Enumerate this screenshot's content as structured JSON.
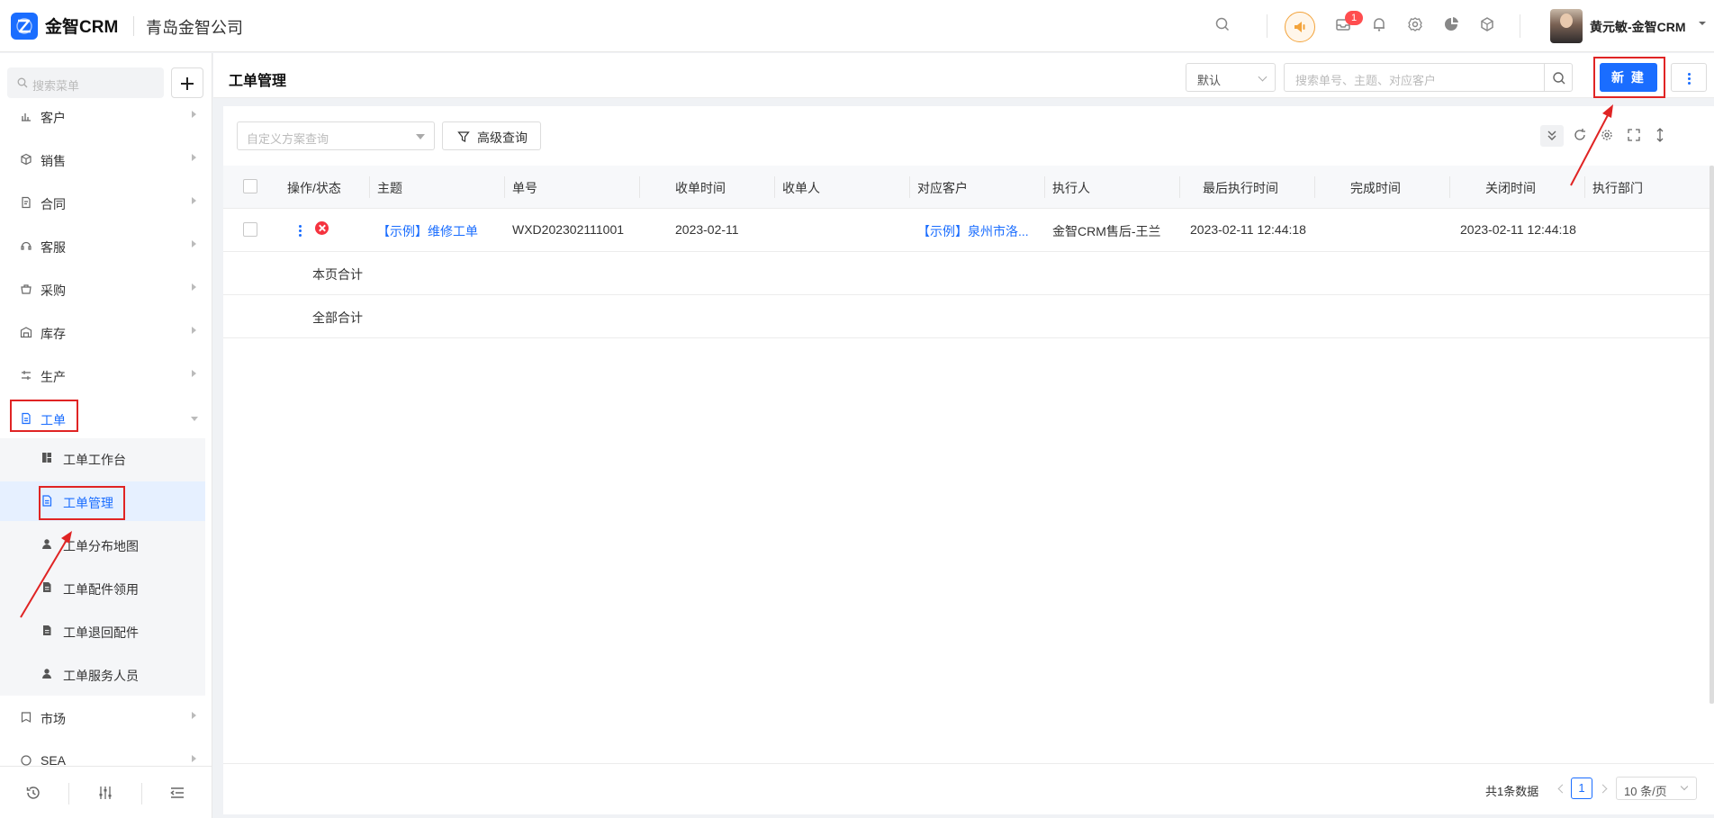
{
  "header": {
    "brand": "金智CRM",
    "company": "青岛金智公司",
    "notification_count": "1",
    "username": "黄元敏-金智CRM"
  },
  "sidebar": {
    "search_placeholder": "搜索菜单",
    "items": [
      {
        "label": "客户",
        "icon": "chart-icon"
      },
      {
        "label": "销售",
        "icon": "cube-icon"
      },
      {
        "label": "合同",
        "icon": "contract-icon"
      },
      {
        "label": "客服",
        "icon": "headset-icon"
      },
      {
        "label": "采购",
        "icon": "basket-icon"
      },
      {
        "label": "库存",
        "icon": "warehouse-icon"
      },
      {
        "label": "生产",
        "icon": "production-icon"
      },
      {
        "label": "工单",
        "icon": "work-order-icon"
      },
      {
        "label": "市场",
        "icon": "market-icon"
      },
      {
        "label": "SEA",
        "icon": "sea-icon"
      }
    ],
    "work_order_children": [
      {
        "label": "工单工作台",
        "icon": "dashboard-icon"
      },
      {
        "label": "工单管理",
        "icon": "document-icon"
      },
      {
        "label": "工单分布地图",
        "icon": "person-icon"
      },
      {
        "label": "工单配件领用",
        "icon": "file-icon"
      },
      {
        "label": "工单退回配件",
        "icon": "file-icon"
      },
      {
        "label": "工单服务人员",
        "icon": "person-icon"
      }
    ]
  },
  "page": {
    "title": "工单管理",
    "view_select": "默认",
    "search_placeholder": "搜索单号、主题、对应客户",
    "new_button": "新 建"
  },
  "toolbar": {
    "scheme_placeholder": "自定义方案查询",
    "advanced_query": "高级查询"
  },
  "table": {
    "columns": [
      "操作/状态",
      "主题",
      "单号",
      "收单时间",
      "收单人",
      "对应客户",
      "执行人",
      "最后执行时间",
      "完成时间",
      "关闭时间",
      "执行部门"
    ],
    "rows": [
      {
        "subject": "【示例】维修工单",
        "order_no": "WXD202302111001",
        "received_time": "2023-02-11",
        "receiver": "",
        "customer": "【示例】泉州市洛...",
        "executor": "金智CRM售后-王兰",
        "last_exec_time": "2023-02-11 12:44:18",
        "done_time": "",
        "close_time": "2023-02-11 12:44:18",
        "department": ""
      }
    ],
    "page_total_label": "本页合计",
    "all_total_label": "全部合计"
  },
  "pagination": {
    "total_text": "共1条数据",
    "current_page": "1",
    "page_size": "10 条/页"
  },
  "colors": {
    "primary": "#1a6dff",
    "highlight": "#e02424",
    "status_closed": "#f5333f"
  }
}
